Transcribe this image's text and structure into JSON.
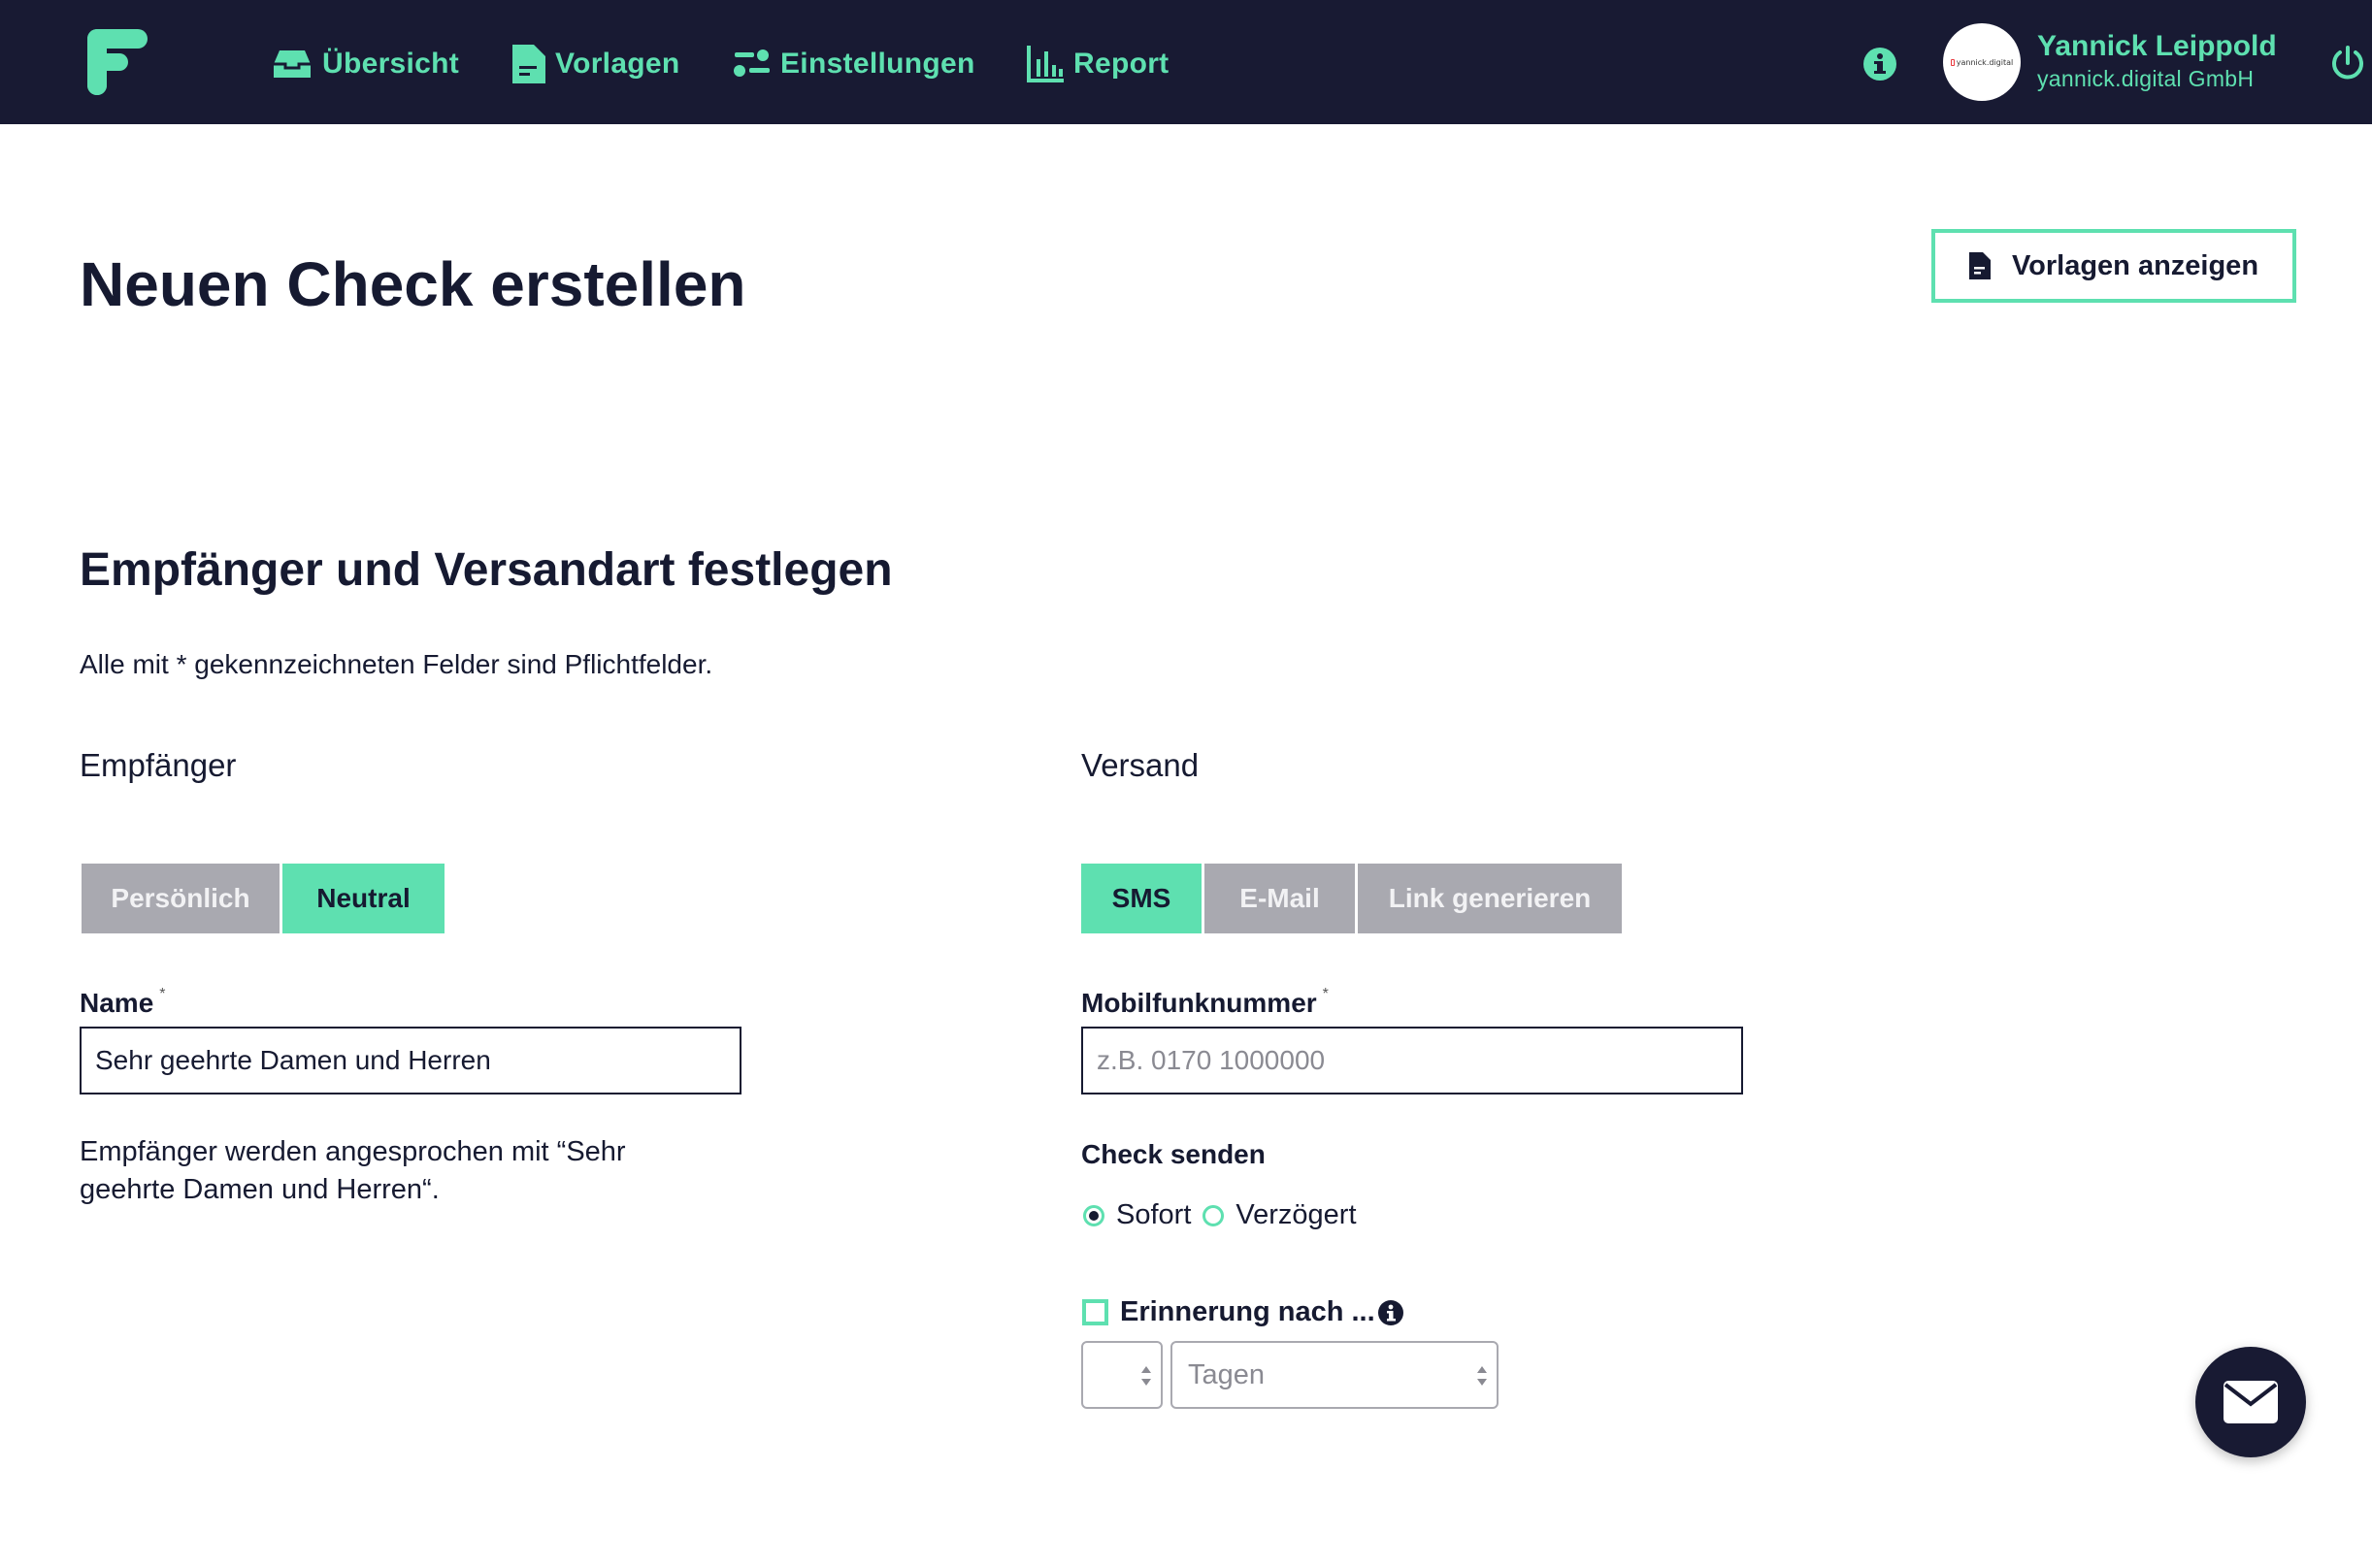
{
  "nav": {
    "items": [
      {
        "label": "Übersicht",
        "icon": "inbox-icon"
      },
      {
        "label": "Vorlagen",
        "icon": "document-icon"
      },
      {
        "label": "Einstellungen",
        "icon": "settings-dots-icon"
      },
      {
        "label": "Report",
        "icon": "bar-chart-icon"
      }
    ],
    "user": {
      "name": "Yannick Leippold",
      "company": "yannick.digital GmbH",
      "avatar_text": "yannick.digital"
    }
  },
  "page": {
    "title": "Neuen Check erstellen",
    "templates_button": "Vorlagen anzeigen"
  },
  "section": {
    "title": "Empfänger und Versandart festlegen",
    "required_note": "Alle mit * gekennzeichneten Felder sind Pflichtfelder."
  },
  "recipient": {
    "label": "Empfänger",
    "modes": [
      "Persönlich",
      "Neutral"
    ],
    "active_mode": "Neutral",
    "name_label": "Name",
    "required_mark": "*",
    "name_value": "Sehr geehrte Damen und Herren",
    "hint": "Empfänger werden angesprochen mit “Sehr geehrte Damen und Herren“."
  },
  "shipping": {
    "label": "Versand",
    "modes": [
      "SMS",
      "E-Mail",
      "Link generieren"
    ],
    "active_mode": "SMS",
    "phone_label": "Mobilfunknummer",
    "required_mark": "*",
    "phone_placeholder": "z.B. 0170 1000000",
    "send_label": "Check senden",
    "send_options": [
      "Sofort",
      "Verzögert"
    ],
    "send_selected": "Sofort",
    "reminder_label": "Erinnerung nach ...",
    "reminder_checked": false,
    "reminder_count_value": "",
    "reminder_unit_placeholder": "Tagen"
  },
  "colors": {
    "nav_bg": "#181a33",
    "accent": "#5ee0b0",
    "text": "#161a31",
    "inactive": "#a9a9b0"
  }
}
